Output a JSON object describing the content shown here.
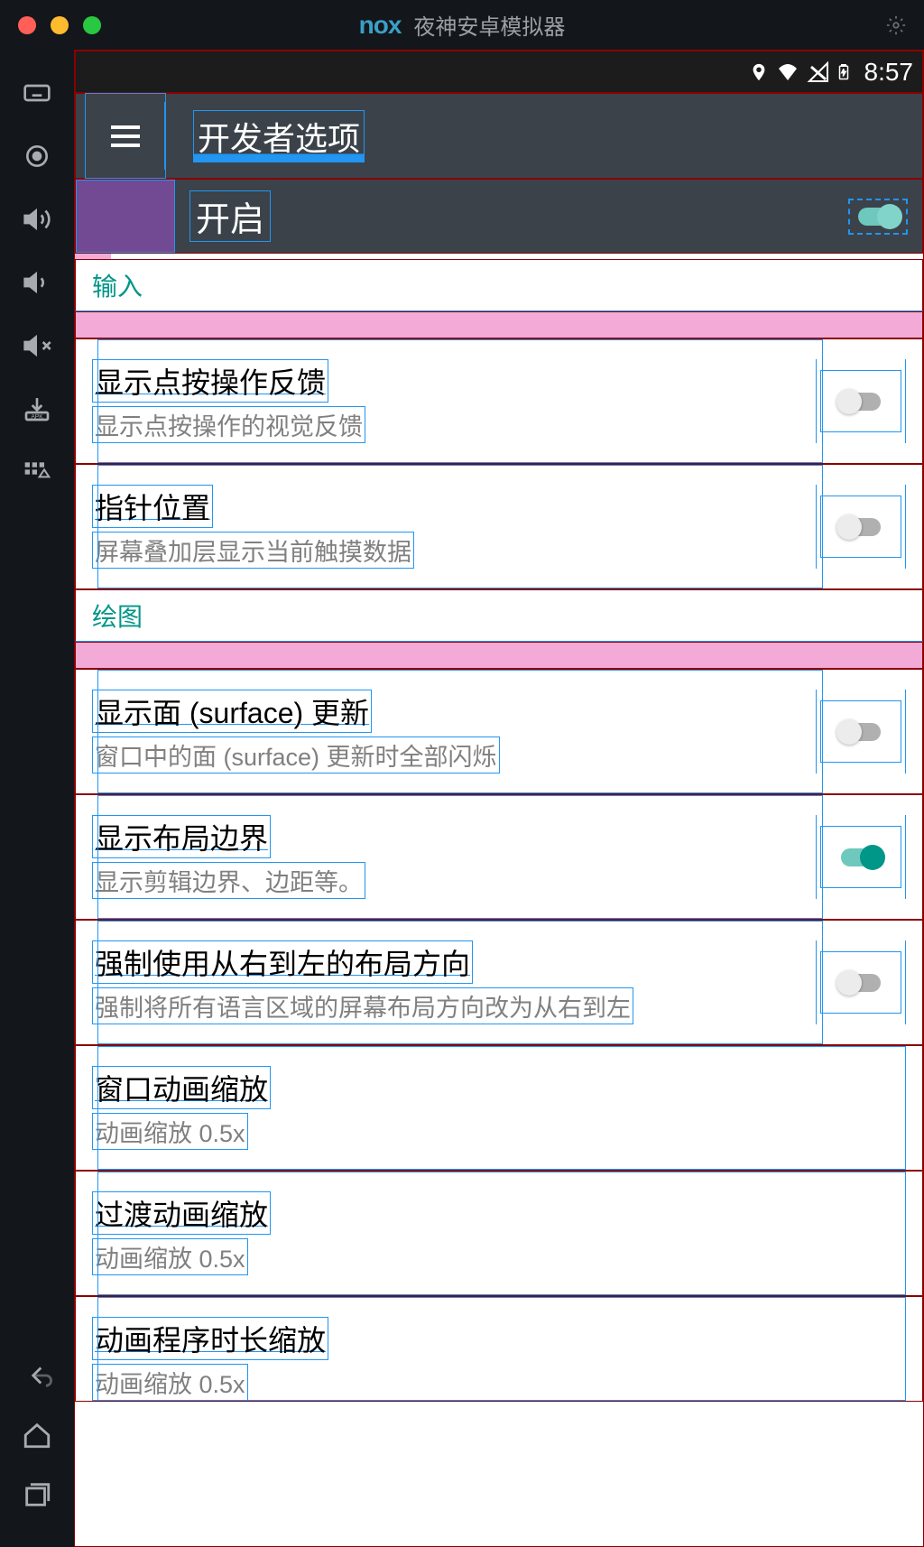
{
  "titlebar": {
    "app_name": "夜神安卓模拟器",
    "logo": "nox"
  },
  "status_bar": {
    "time": "8:57"
  },
  "app_bar": {
    "title": "开发者选项"
  },
  "master_toggle": {
    "label": "开启",
    "on": true
  },
  "sections": [
    {
      "header": "输入",
      "items": [
        {
          "title": "显示点按操作反馈",
          "sub": "显示点按操作的视觉反馈",
          "switch": true,
          "on": false
        },
        {
          "title": "指针位置",
          "sub": "屏幕叠加层显示当前触摸数据",
          "switch": true,
          "on": false
        }
      ]
    },
    {
      "header": "绘图",
      "items": [
        {
          "title": "显示面 (surface) 更新",
          "sub": "窗口中的面 (surface) 更新时全部闪烁",
          "switch": true,
          "on": false
        },
        {
          "title": "显示布局边界",
          "sub": "显示剪辑边界、边距等。",
          "switch": true,
          "on": true
        },
        {
          "title": "强制使用从右到左的布局方向",
          "sub": "强制将所有语言区域的屏幕布局方向改为从右到左",
          "switch": true,
          "on": false
        },
        {
          "title": "窗口动画缩放",
          "sub": "动画缩放 0.5x",
          "switch": false
        },
        {
          "title": "过渡动画缩放",
          "sub": "动画缩放 0.5x",
          "switch": false
        },
        {
          "title": "动画程序时长缩放",
          "sub": "动画缩放 0.5x",
          "switch": false
        }
      ]
    }
  ]
}
